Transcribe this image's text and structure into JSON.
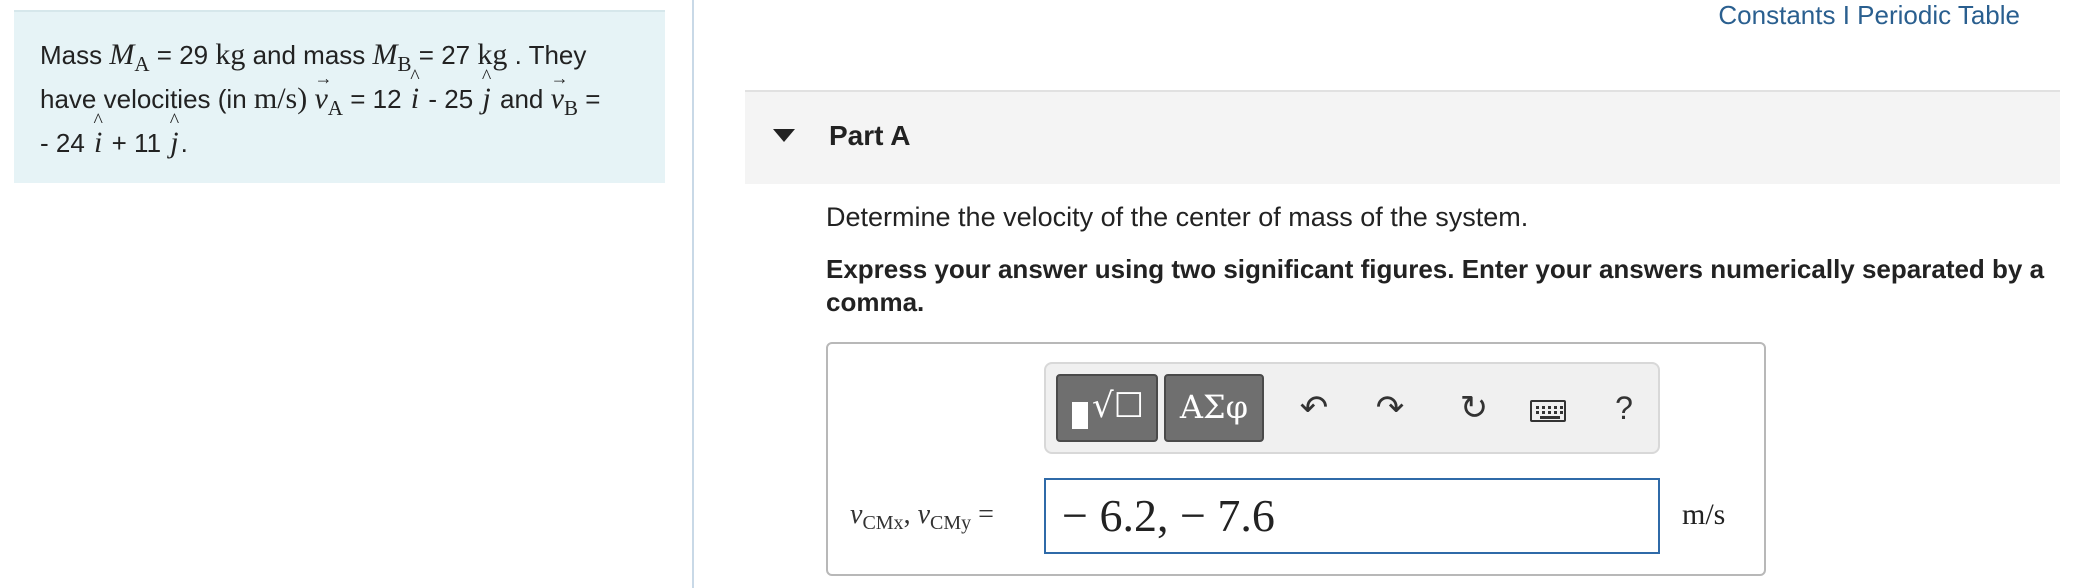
{
  "problem": {
    "t_mass": "Mass",
    "M": "M",
    "sub_A": "A",
    "sub_B": "B",
    "eq": "=",
    "mass_A_value": "29",
    "unit_kg": "kg",
    "t_and_mass": "and mass",
    "mass_B_value": "27",
    "t_they": ". They",
    "t_have_vel": "have velocities (in",
    "unit_ms_paren": "m/s)",
    "v": "v",
    "vA_i": "12",
    "minus": "-",
    "vA_j": "25",
    "i_hat": "i",
    "j_hat": "j",
    "t_and": "and",
    "vB_i": "- 24",
    "plus": "+",
    "vB_j": "11",
    "period": "."
  },
  "header_links": {
    "constants": "Constants",
    "separator": " I ",
    "periodic_table": "Periodic Table"
  },
  "part": {
    "title": "Part A"
  },
  "question": {
    "text": "Determine the velocity of the center of mass of the system.",
    "instructions": "Express your answer using two significant figures. Enter your answers numerically separated by a comma."
  },
  "toolbar": {
    "greek_label": "ΑΣφ",
    "help_label": "?",
    "icons": [
      "templates-icon",
      "greek-icon",
      "undo-icon",
      "redo-icon",
      "reset-icon",
      "keyboard-icon",
      "help-icon"
    ]
  },
  "answer": {
    "v": "v",
    "sub_x": "CMx",
    "sub_y": "CMy",
    "comma": ",",
    "eq": "=",
    "value": "− 6.2, − 7.6",
    "units": "m/s"
  },
  "colors": {
    "problem_bg": "#e6f3f6",
    "link": "#2a5f8f",
    "input_border": "#2f6aa8",
    "part_header_bg": "#f4f4f4"
  }
}
